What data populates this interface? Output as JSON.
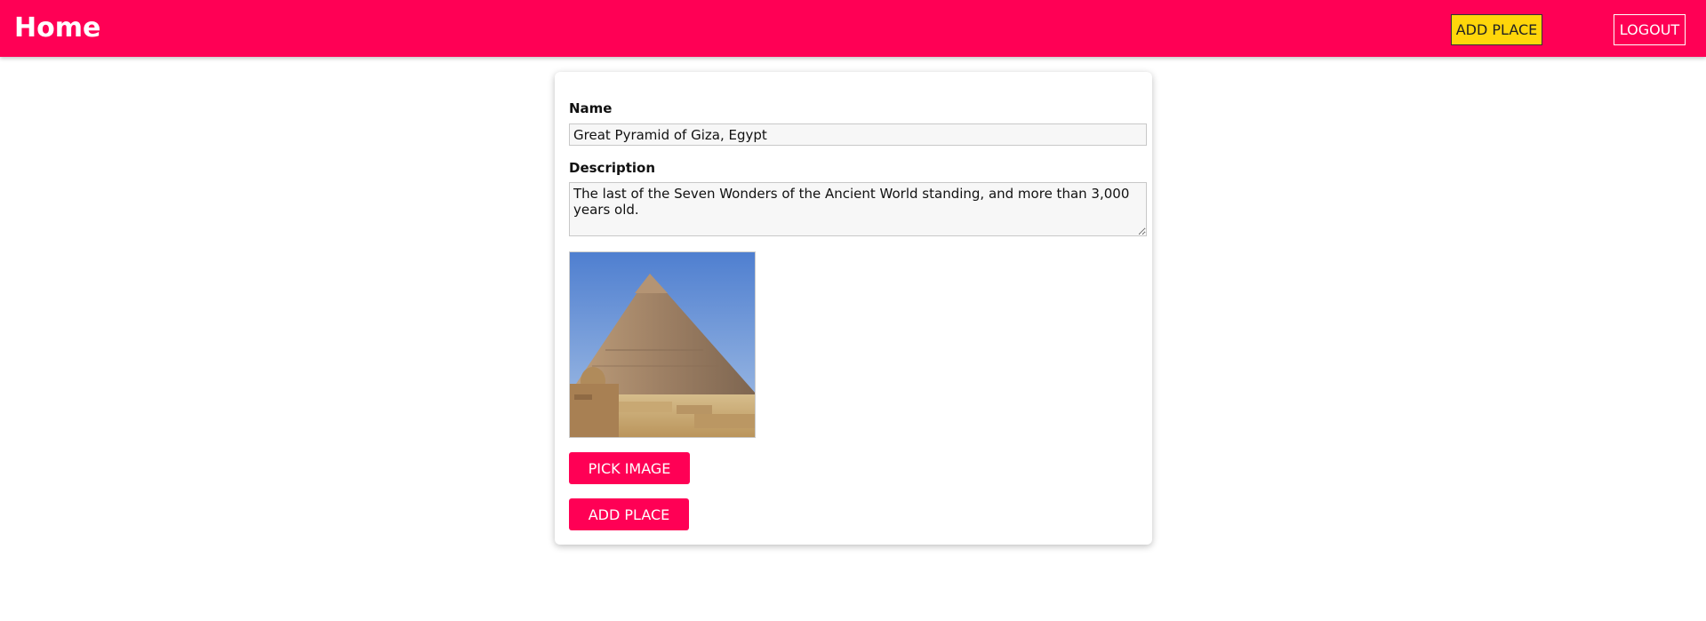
{
  "header": {
    "title": "Home",
    "add_place_label": "ADD PLACE",
    "logout_label": "LOGOUT"
  },
  "form": {
    "name_label": "Name",
    "name_value": "Great Pyramid of Giza, Egypt",
    "description_label": "Description",
    "description_value": "The last of the Seven Wonders of the Ancient World standing, and more than 3,000 years old.",
    "pick_image_label": "PICK IMAGE",
    "submit_label": "ADD PLACE"
  },
  "colors": {
    "accent": "#ff0055",
    "header_button": "#ffd60a"
  }
}
